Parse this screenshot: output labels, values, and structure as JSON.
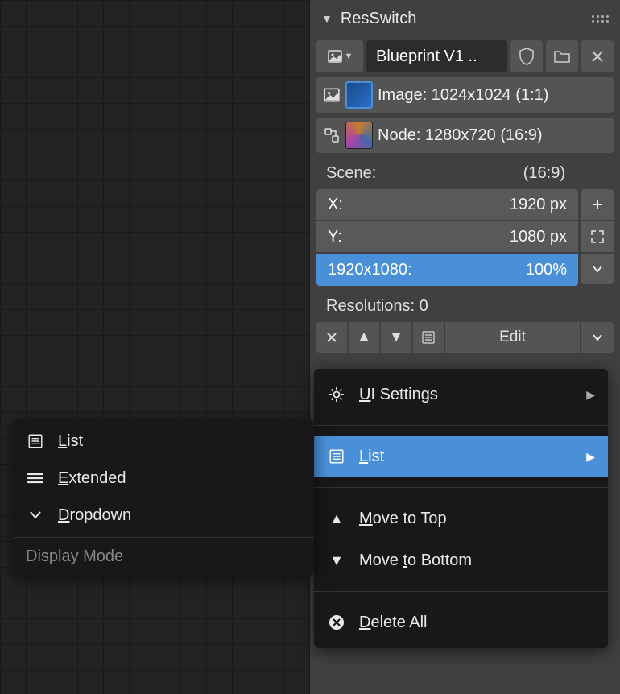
{
  "panel": {
    "title": "ResSwitch",
    "image_name": "Blueprint V1 ..",
    "image_info": "Image: 1024x1024 (1:1)",
    "node_info": "Node: 1280x720 (16:9)",
    "scene_label": "Scene:",
    "scene_ratio": "(16:9)",
    "x_label": "X:",
    "x_value": "1920 px",
    "y_label": "Y:",
    "y_value": "1080 px",
    "res_label": "1920x1080:",
    "res_pct": "100%",
    "resolutions_label": "Resolutions: 0",
    "edit_label": "Edit"
  },
  "menu": {
    "ui_settings": "UI Settings",
    "list": "List",
    "move_top": "Move to Top",
    "move_bottom": "Move to Bottom",
    "delete_all": "Delete All"
  },
  "submenu": {
    "list": "List",
    "extended": "Extended",
    "dropdown": "Dropdown",
    "title": "Display Mode"
  }
}
